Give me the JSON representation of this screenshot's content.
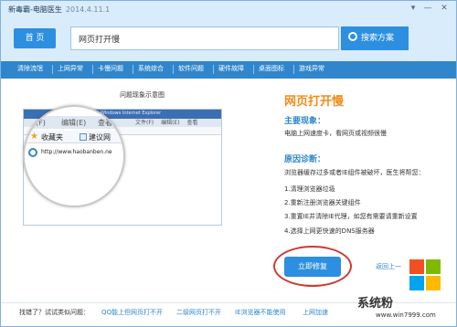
{
  "window": {
    "app_name": "新毒霸-电脑医生",
    "version": "2014.4.11.1"
  },
  "header": {
    "home_label": "首 页",
    "search_value": "网页打开慢",
    "search_button_label": "搜索方案"
  },
  "categories": [
    "清除流氓",
    "上网异常",
    "卡慢问题",
    "系统综合",
    "软件问题",
    "硬件故障",
    "桌面图标",
    "游戏异常"
  ],
  "illustration": {
    "title": "问题现象示意图",
    "browser_title": "Windows Internet Explorer",
    "menu": [
      "文件(F)",
      "编辑(E)",
      "查看"
    ],
    "mag_menu": [
      "件(F)",
      "编辑(E)",
      "查看"
    ],
    "favorites_label": "收藏夹",
    "suggest_label": "建议网",
    "url": "http://www.haobanben.ne"
  },
  "problem": {
    "title": "网页打开慢",
    "symptom_heading": "主要现象：",
    "symptom_text": "电脑上网速度卡，看网页或视频很慢",
    "diagnosis_heading": "原因诊断：",
    "diagnosis_text": "浏览器缓存过多或者IE组件被破坏，医生将帮您：",
    "steps": [
      "1.清理浏览器垃圾",
      "2.重新注册浏览器关键组件",
      "3.重置IE并清除IE代理，如您有需要请重新设置",
      "4.选择上网更快速的DNS服务器"
    ],
    "repair_button": "立即修复",
    "back_link": "返回上一"
  },
  "footer": {
    "label": "找错了？试试类似问题：",
    "links": [
      "QQ能上但网页打不开",
      "二级网页打不开",
      "IE浏览器不能使用",
      "上网加速"
    ]
  },
  "watermark": {
    "brand": "系统粉",
    "url": "www.win7999.com"
  }
}
